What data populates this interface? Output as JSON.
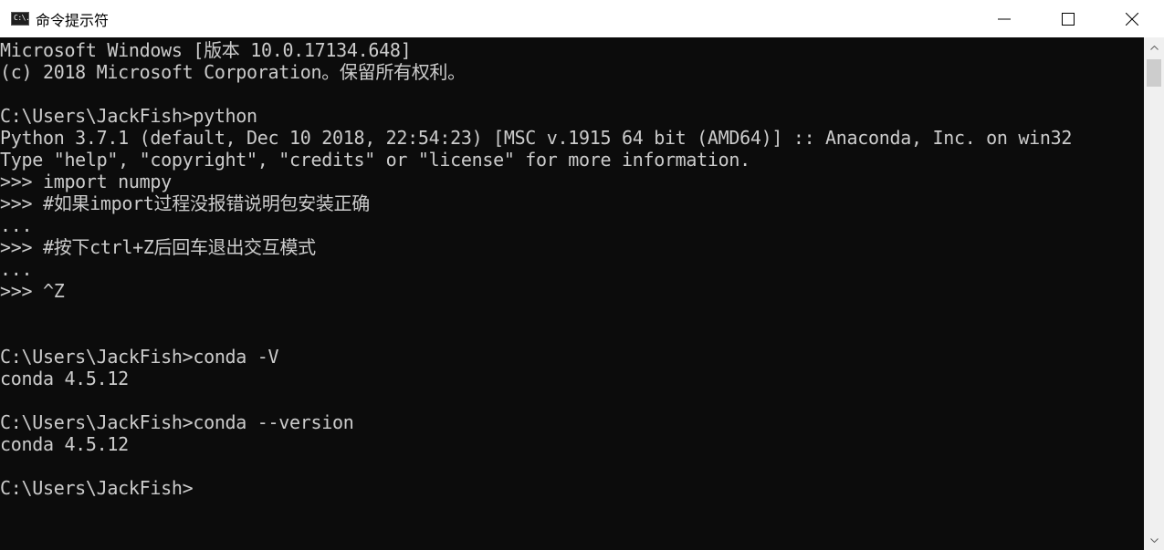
{
  "window": {
    "title": "命令提示符",
    "icon": "cmd-icon",
    "icon_text": "C:\\."
  },
  "controls": {
    "minimize": "minimize-icon",
    "maximize": "maximize-icon",
    "close": "close-icon"
  },
  "console": {
    "lines": [
      "Microsoft Windows [版本 10.0.17134.648]",
      "(c) 2018 Microsoft Corporation。保留所有权利。",
      "",
      "C:\\Users\\JackFish>python",
      "Python 3.7.1 (default, Dec 10 2018, 22:54:23) [MSC v.1915 64 bit (AMD64)] :: Anaconda, Inc. on win32",
      "Type \"help\", \"copyright\", \"credits\" or \"license\" for more information.",
      ">>> import numpy",
      ">>> #如果import过程没报错说明包安装正确",
      "...",
      ">>> #按下ctrl+Z后回车退出交互模式",
      "...",
      ">>> ^Z",
      "",
      "",
      "C:\\Users\\JackFish>conda -V",
      "conda 4.5.12",
      "",
      "C:\\Users\\JackFish>conda --version",
      "conda 4.5.12",
      "",
      "C:\\Users\\JackFish>"
    ]
  },
  "colors": {
    "console_bg": "#0c0c0c",
    "console_fg": "#cccccc",
    "titlebar_bg": "#ffffff"
  }
}
